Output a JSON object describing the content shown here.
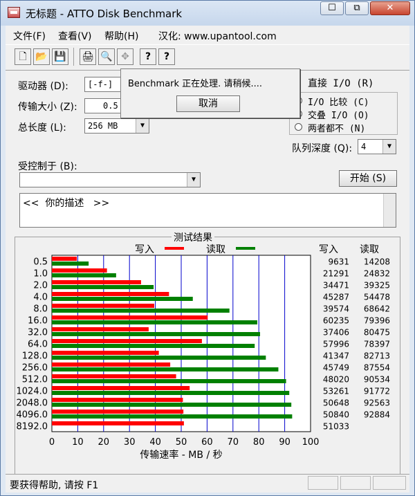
{
  "window": {
    "title": "无标题 - ATTO Disk Benchmark",
    "min_glyph": "☐",
    "max_glyph": "⧉",
    "close_glyph": "✕"
  },
  "menu": {
    "file": "文件(F)",
    "view": "查看(V)",
    "help": "帮助(H)",
    "credit": "汉化: www.upantool.com"
  },
  "toolbar": {
    "icons": [
      "new-file-icon",
      "open-folder-icon",
      "save-icon",
      "print-icon",
      "print-preview-icon",
      "move-icon",
      "help-icon",
      "context-help-icon"
    ],
    "glyphs": [
      "🗋",
      "📂",
      "💾",
      "🖨",
      "🔍",
      "✥",
      "?",
      "?"
    ]
  },
  "settings": {
    "drive_label": "驱动器 (D):",
    "drive_value": "[-f-]",
    "transfer_label": "传输大小 (Z):",
    "transfer_value": "0.5",
    "length_label": "总长度 (L):",
    "length_value": "256 MB",
    "direct_io_label": "直接 I/O (R)",
    "direct_io_checked": true,
    "io_compare_label": "I/O 比较 (C)",
    "overlap_io_label": "交叠 I/O (O)",
    "neither_label": "两者都不 (N)",
    "selected_mode": "overlap_io",
    "queue_depth_label": "队列深度 (Q):",
    "queue_depth_value": "4",
    "controlled_by_label": "受控制于 (B):",
    "controlled_by_value": "",
    "start_button": "开始 (S)",
    "description": "<<  你的描述   >>"
  },
  "dialog": {
    "message": "Benchmark 正在处理.  请稍候....",
    "cancel": "取消"
  },
  "results": {
    "group_title": "测试结果",
    "legend_write": "写入",
    "legend_read": "读取",
    "col_write": "写入",
    "col_read": "读取",
    "write_color": "#ff0000",
    "read_color": "#008000"
  },
  "chart_data": {
    "type": "bar",
    "orientation": "horizontal",
    "categories": [
      "0.5",
      "1.0",
      "2.0",
      "4.0",
      "8.0",
      "16.0",
      "32.0",
      "64.0",
      "128.0",
      "256.0",
      "512.0",
      "1024.0",
      "2048.0",
      "4096.0",
      "8192.0"
    ],
    "series": [
      {
        "name": "写入",
        "values": [
          9631,
          21291,
          34471,
          45287,
          39574,
          60235,
          37406,
          57996,
          41347,
          45749,
          48020,
          53261,
          50648,
          50840,
          51033
        ]
      },
      {
        "name": "读取",
        "values": [
          14208,
          24832,
          39325,
          54478,
          68642,
          79396,
          80475,
          78397,
          82713,
          87554,
          90534,
          91772,
          92563,
          92884,
          null
        ]
      }
    ],
    "value_table": {
      "write": [
        "9631",
        "21291",
        "34471",
        "45287",
        "39574",
        "60235",
        "37406",
        "57996",
        "41347",
        "45749",
        "48020",
        "53261",
        "50648",
        "50840",
        "51033"
      ],
      "read": [
        "14208",
        "24832",
        "39325",
        "54478",
        "68642",
        "79396",
        "80475",
        "78397",
        "82713",
        "87554",
        "90534",
        "91772",
        "92563",
        "92884",
        ""
      ]
    },
    "xlabel": "传输速率 - MB / 秒",
    "xlim": [
      0,
      100
    ],
    "xticks": [
      "0",
      "10",
      "20",
      "30",
      "40",
      "50",
      "60",
      "70",
      "80",
      "90",
      "100"
    ],
    "grid": true
  },
  "status": {
    "text": "要获得帮助, 请按 F1"
  }
}
